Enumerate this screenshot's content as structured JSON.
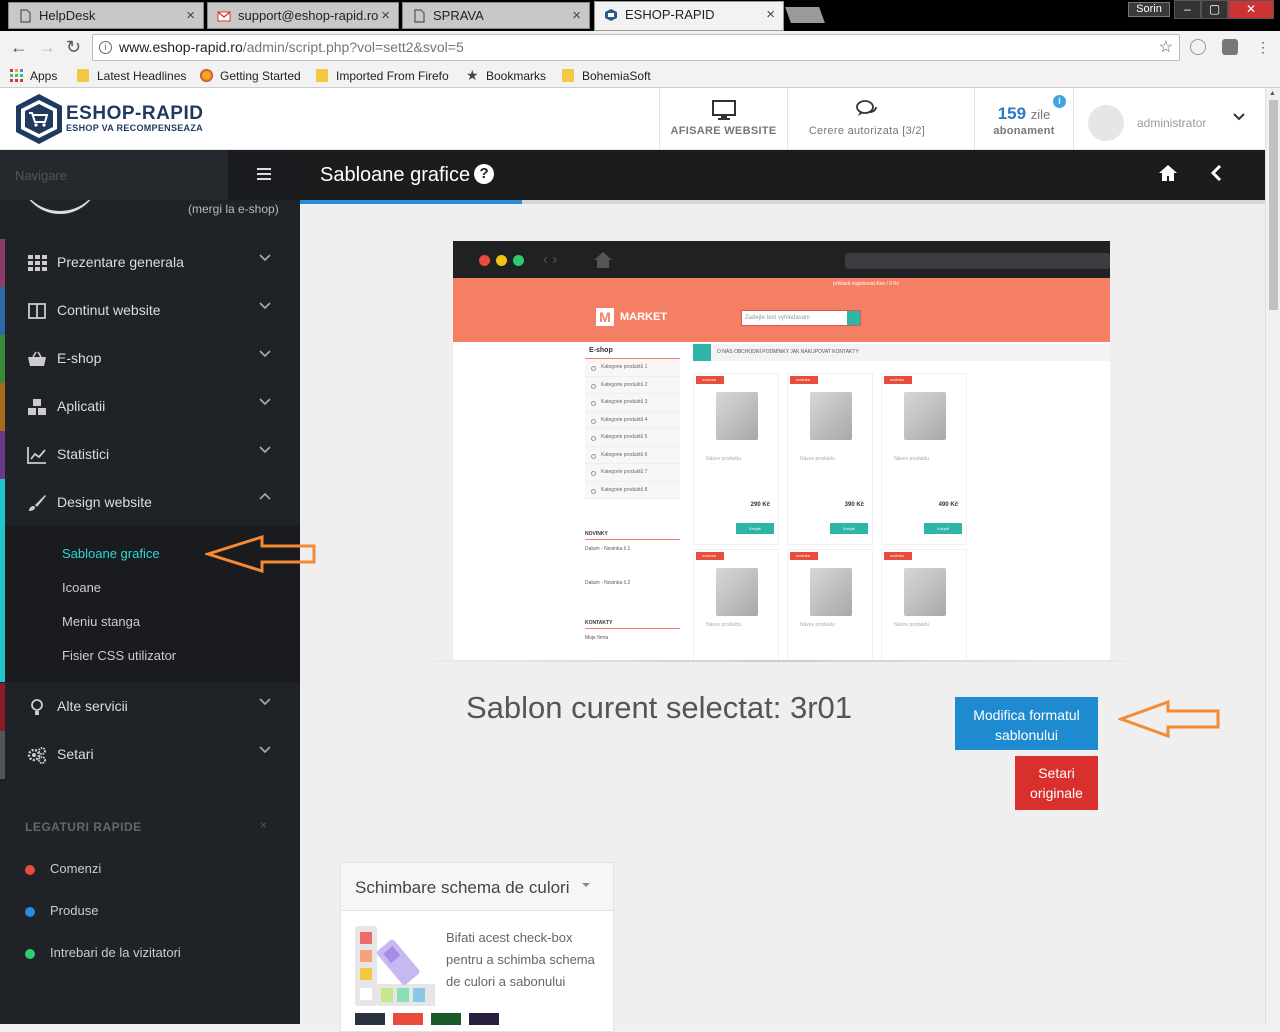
{
  "browser": {
    "tabs": [
      {
        "label": "HelpDesk"
      },
      {
        "label": "support@eshop-rapid.ro"
      },
      {
        "label": "SPRAVA"
      },
      {
        "label": "ESHOP-RAPID"
      }
    ],
    "user_badge": "Sorin",
    "url_host": "www.eshop-rapid.ro",
    "url_path": "/admin/script.php?vol=sett2&svol=5",
    "bookmarks": [
      "Apps",
      "Latest Headlines",
      "Getting Started",
      "Imported From Firefo",
      "Bookmarks",
      "BohemiaSoft"
    ]
  },
  "header": {
    "logo_title": "ESHOP-RAPID",
    "logo_subtitle": "ESHOP VA RECOMPENSEAZA",
    "view_website": "AFISARE WEBSITE",
    "auth_request": "Cerere autorizata [3/2]",
    "days_count": "159",
    "days_unit": "zile",
    "subscription": "abonament",
    "admin_name": "administrator"
  },
  "sidebar": {
    "search_placeholder": "Navigare",
    "eshop_link": "(mergi la e-shop)",
    "items": [
      {
        "label": "Prezentare generala",
        "color": "#8e3a6b"
      },
      {
        "label": "Continut website",
        "color": "#2a6aa8"
      },
      {
        "label": "E-shop",
        "color": "#3a8a3a"
      },
      {
        "label": "Aplicatii",
        "color": "#a86a1a"
      },
      {
        "label": "Statistici",
        "color": "#6a3a8a"
      },
      {
        "label": "Design website",
        "color": "#1ec8c8"
      },
      {
        "label": "Alte servicii",
        "color": "#8a1a2a"
      },
      {
        "label": "Setari",
        "color": "#555555"
      }
    ],
    "subitems": [
      {
        "label": "Sabloane grafice"
      },
      {
        "label": "Icoane"
      },
      {
        "label": "Meniu stanga"
      },
      {
        "label": "Fisier CSS utilizator"
      }
    ],
    "quick_links_title": "LEGATURI RAPIDE",
    "quick_links": [
      {
        "label": "Comenzi",
        "color": "#e74c3c"
      },
      {
        "label": "Produse",
        "color": "#2a8bd8"
      },
      {
        "label": "Intrebari de la vizitatori",
        "color": "#2ecc71"
      }
    ]
  },
  "main": {
    "title": "Sabloane grafice",
    "progress_percent": 23,
    "current_template": "Sablon curent selectat: 3r01",
    "modify_button_line1": "Modifica formatul",
    "modify_button_line2": "sablonului",
    "reset_button_line1": "Setari",
    "reset_button_line2": "originale",
    "color_panel_title": "Schimbare schema de culori",
    "color_panel_text": "Bifati acest check-box pentru a schimba schema de culori a sabonului"
  },
  "preview": {
    "brand": "MARKET",
    "search_placeholder": "Zadejte text vyhledavani",
    "top_links": "prihlasit   registrovat   Kos / 0 Kc",
    "left_head": "E-shop",
    "categories": [
      "Kategorie produktů 1",
      "Kategorie produktů 2",
      "Kategorie produktů 3",
      "Kategorie produktů 4",
      "Kategorie produktů 5",
      "Kategorie produktů 6",
      "Kategorie produktů 7",
      "Kategorie produktů 8"
    ],
    "menu_items": "O NÁS    OBCHODNÍ PODMÍNKY    JAK NAKUPOVAT    KONTAKTY",
    "badge": "novinka",
    "product_name": "Název produktu",
    "prices": [
      "290 Kč",
      "390 Kč",
      "490 Kč"
    ],
    "buy": "Koupit",
    "news_head": "NOVINKY",
    "news_1": "Datum - Novinka č.1",
    "news_2": "Datum - Novinka č.2",
    "contacts_head": "KONTAKTY",
    "contacts_company": "Moje firma"
  }
}
